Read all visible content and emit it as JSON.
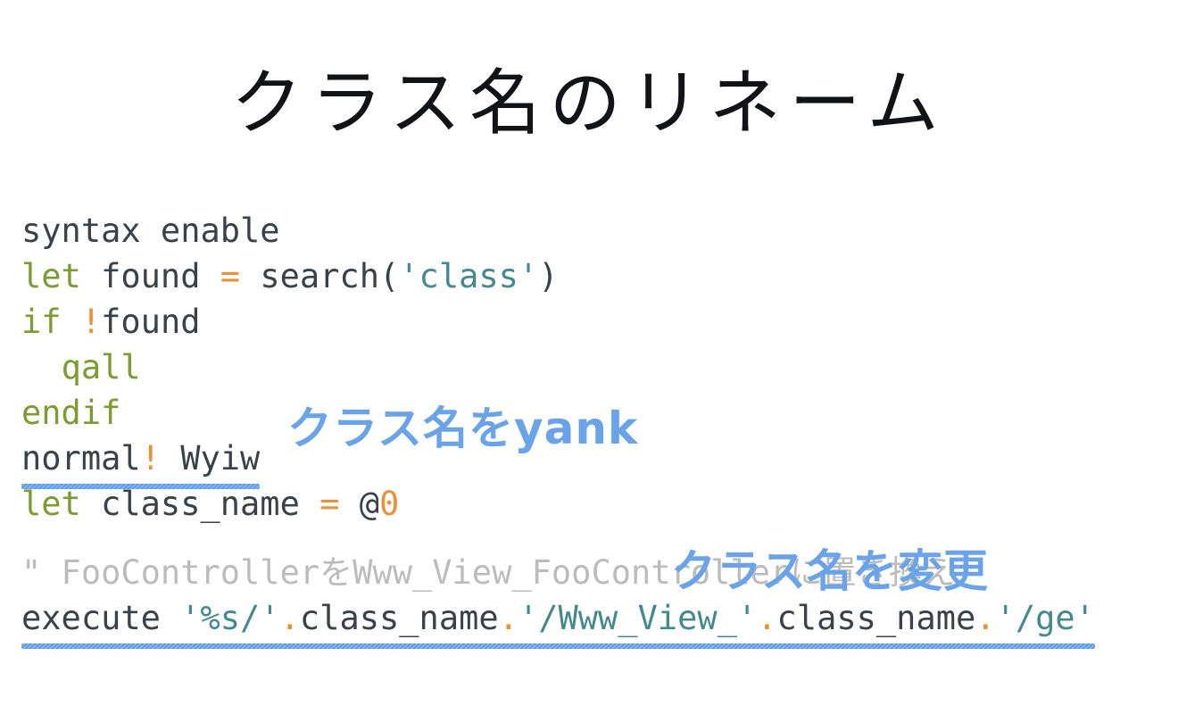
{
  "slide": {
    "title": "クラス名のリネーム",
    "background_color": "#ffffff"
  },
  "colors": {
    "plain": "#3b4149",
    "keyword": "#7d9a35",
    "operator": "#e8913a",
    "string": "#46898c",
    "comment": "#bcbcbc",
    "annotation_blue": "#6ba3e8",
    "underline_blue": "#4f92e8",
    "title": "#111316"
  },
  "code": {
    "language": "vimscript",
    "lines": [
      {
        "id": "line-syntax-enable",
        "text": "syntax enable",
        "underlined": false,
        "tokens": [
          {
            "text": "syntax enable",
            "type": "plain"
          }
        ]
      },
      {
        "id": "line-let-found",
        "text": "let found = search('class')",
        "underlined": false,
        "tokens": [
          {
            "text": "let",
            "type": "keyword"
          },
          {
            "text": " found ",
            "type": "plain"
          },
          {
            "text": "=",
            "type": "op"
          },
          {
            "text": " search(",
            "type": "plain"
          },
          {
            "text": "'class'",
            "type": "string"
          },
          {
            "text": ")",
            "type": "plain"
          }
        ]
      },
      {
        "id": "line-if-found",
        "text": "if !found",
        "underlined": false,
        "tokens": [
          {
            "text": "if",
            "type": "keyword"
          },
          {
            "text": " ",
            "type": "plain"
          },
          {
            "text": "!",
            "type": "op"
          },
          {
            "text": "found",
            "type": "plain"
          }
        ]
      },
      {
        "id": "line-qall",
        "text": "  qall",
        "underlined": false,
        "tokens": [
          {
            "text": "  ",
            "type": "plain"
          },
          {
            "text": "qall",
            "type": "keyword"
          }
        ]
      },
      {
        "id": "line-endif",
        "text": "endif",
        "underlined": false,
        "tokens": [
          {
            "text": "endif",
            "type": "keyword"
          }
        ]
      },
      {
        "id": "line-normal-wyiw",
        "text": "normal! Wyiw",
        "underlined": true,
        "tokens": [
          {
            "text": "normal",
            "type": "plain"
          },
          {
            "text": "!",
            "type": "op"
          },
          {
            "text": " Wyiw",
            "type": "plain"
          }
        ]
      },
      {
        "id": "line-let-class-name",
        "text": "let class_name = @0",
        "underlined": false,
        "tokens": [
          {
            "text": "let",
            "type": "keyword"
          },
          {
            "text": " class_name ",
            "type": "plain"
          },
          {
            "text": "=",
            "type": "op"
          },
          {
            "text": " @",
            "type": "plain"
          },
          {
            "text": "0",
            "type": "op"
          }
        ]
      },
      {
        "id": "line-blank",
        "text": "",
        "underlined": false,
        "blank": true,
        "tokens": []
      },
      {
        "id": "line-comment",
        "text": "\" FooControllerをWww_View_FooControllerに置き換え",
        "underlined": false,
        "tokens": [
          {
            "text": "\" FooControllerをWww_View_FooControllerに置き換え",
            "type": "comment"
          }
        ]
      },
      {
        "id": "line-execute",
        "text": "execute '%s/'.class_name.'/Www_View_'.class_name.'/ge'",
        "underlined": true,
        "tokens": [
          {
            "text": "execute ",
            "type": "plain"
          },
          {
            "text": "'%s/'",
            "type": "string"
          },
          {
            "text": ".",
            "type": "op"
          },
          {
            "text": "class_name",
            "type": "plain"
          },
          {
            "text": ".",
            "type": "op"
          },
          {
            "text": "'/Www_View_'",
            "type": "string"
          },
          {
            "text": ".",
            "type": "op"
          },
          {
            "text": "class_name",
            "type": "plain"
          },
          {
            "text": ".",
            "type": "op"
          },
          {
            "text": "'/ge'",
            "type": "string"
          }
        ]
      }
    ]
  },
  "annotations": [
    {
      "id": "annotation-yank",
      "text": "クラス名をyank",
      "points_to": "line-normal-wyiw"
    },
    {
      "id": "annotation-rename",
      "text": "クラス名を変更",
      "points_to": "line-execute"
    }
  ]
}
